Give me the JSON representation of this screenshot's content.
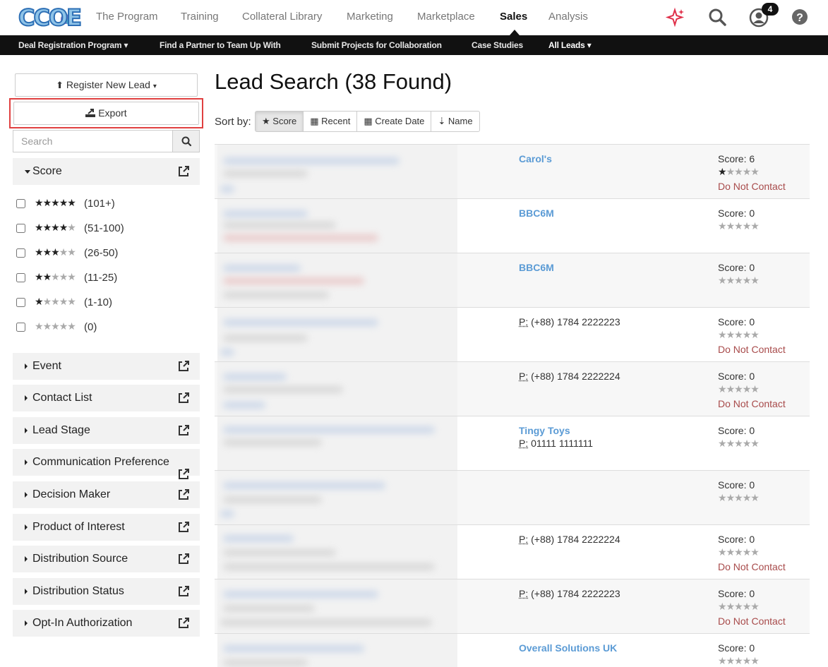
{
  "nav": {
    "logo": "CCOE",
    "items": [
      "The Program",
      "Training",
      "Collateral Library",
      "Marketing",
      "Marketplace",
      "Sales",
      "Analysis"
    ],
    "active_index": 5,
    "notification_count": "4"
  },
  "subnav": {
    "items": [
      "Deal Registration Program",
      "Find a Partner to Team Up With",
      "Submit Projects for Collaboration",
      "Case Studies",
      "All Leads"
    ]
  },
  "sidebar": {
    "register_label": "Register New Lead",
    "export_label": "Export",
    "search_placeholder": "Search",
    "score_facet": "Score",
    "score_options": [
      {
        "stars": 5,
        "range": "(101+)"
      },
      {
        "stars": 4,
        "range": "(51-100)"
      },
      {
        "stars": 3,
        "range": "(26-50)"
      },
      {
        "stars": 2,
        "range": "(11-25)"
      },
      {
        "stars": 1,
        "range": "(1-10)"
      },
      {
        "stars": 0,
        "range": "(0)"
      }
    ],
    "facets": [
      "Event",
      "Contact List",
      "Lead Stage",
      "Communication Preference",
      "Decision Maker",
      "Product of Interest",
      "Distribution Source",
      "Distribution Status",
      "Opt-In Authorization"
    ]
  },
  "main": {
    "title": "Lead Search  (38 Found)",
    "sort_label": "Sort by:",
    "sort_options": [
      "Score",
      "Recent",
      "Create Date",
      "Name"
    ],
    "sort_active": 0,
    "phone_prefix": "P:",
    "results": [
      {
        "company": "Carol's",
        "phone": "",
        "score": "Score: 6",
        "stars": 1,
        "dnc": "Do Not Contact"
      },
      {
        "company": "BBC6M",
        "phone": "",
        "score": "Score: 0",
        "stars": 0,
        "dnc": ""
      },
      {
        "company": "BBC6M",
        "phone": "",
        "score": "Score: 0",
        "stars": 0,
        "dnc": ""
      },
      {
        "company": "",
        "phone": "(+88) 1784 2222223",
        "score": "Score: 0",
        "stars": 0,
        "dnc": "Do Not Contact"
      },
      {
        "company": "",
        "phone": "(+88) 1784 2222224",
        "score": "Score: 0",
        "stars": 0,
        "dnc": "Do Not Contact"
      },
      {
        "company": "Tingy Toys",
        "phone": "01111 1111111",
        "score": "Score: 0",
        "stars": 0,
        "dnc": ""
      },
      {
        "company": "",
        "phone": "",
        "score": "Score: 0",
        "stars": 0,
        "dnc": ""
      },
      {
        "company": "",
        "phone": "(+88) 1784 2222224",
        "score": "Score: 0",
        "stars": 0,
        "dnc": "Do Not Contact"
      },
      {
        "company": "",
        "phone": "(+88) 1784 2222223",
        "score": "Score: 0",
        "stars": 0,
        "dnc": "Do Not Contact"
      },
      {
        "company": "Overall Solutions UK",
        "phone": "",
        "score": "Score: 0",
        "stars": 0,
        "dnc": ""
      }
    ]
  }
}
